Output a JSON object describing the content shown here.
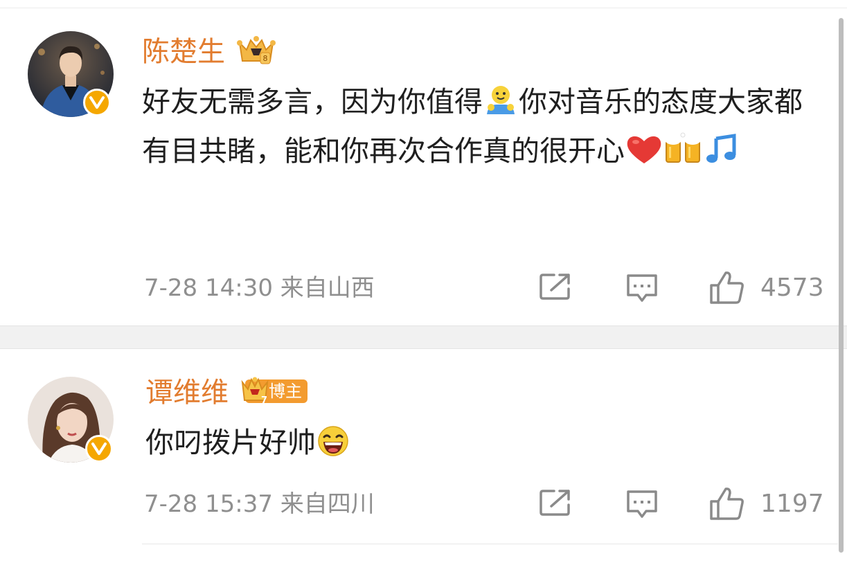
{
  "comments": [
    {
      "username": "陈楚生",
      "badge_label": "",
      "text_before": "好友无需多言，因为你值得",
      "text_after": "你对音乐的态度大家都有目共睹，能和你再次合作真的很开心",
      "time": "7-28 14:30",
      "location": "来自山西",
      "likes": "4573"
    },
    {
      "username": "谭维维",
      "badge_label": "博主",
      "text": "你叼拨片好帅",
      "time": "7-28 15:37",
      "location": "来自四川",
      "likes": "1197"
    }
  ],
  "icons": {
    "verified": "verified-v-icon",
    "share": "share-icon",
    "comment": "comment-icon",
    "like": "thumbs-up-icon"
  },
  "colors": {
    "username": "#e27c2f",
    "verified": "#f5a700",
    "meta": "#8f8f8f",
    "separator": "#f1f1f1"
  }
}
